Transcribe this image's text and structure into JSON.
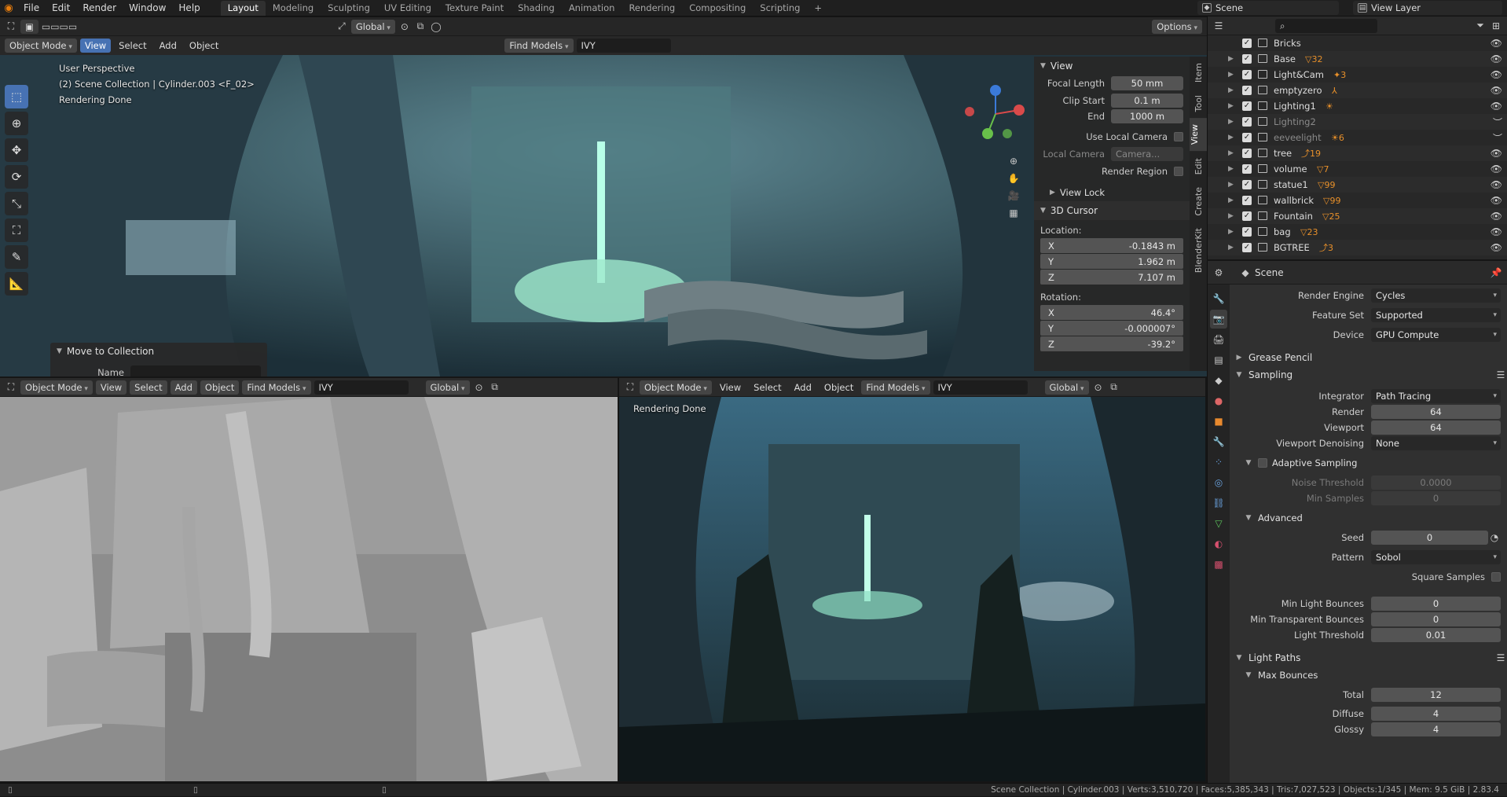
{
  "topbar": {
    "menus": [
      "File",
      "Edit",
      "Render",
      "Window",
      "Help"
    ],
    "workspaces": [
      "Layout",
      "Modeling",
      "Sculpting",
      "UV Editing",
      "Texture Paint",
      "Shading",
      "Animation",
      "Rendering",
      "Compositing",
      "Scripting"
    ],
    "active_workspace": "Layout",
    "scene_name": "Scene",
    "view_layer": "View Layer"
  },
  "viewport_main": {
    "mode": "Object Mode",
    "menus": [
      "View",
      "Select",
      "Add",
      "Object"
    ],
    "transform_orientation": "Global",
    "find_models": "Find Models",
    "search": "IVY",
    "options": "Options",
    "overlay_lines": [
      "User Perspective",
      "(2) Scene Collection | Cylinder.003 <F_02>",
      "Rendering Done"
    ],
    "last_op": {
      "title": "Move to Collection",
      "name_label": "Name",
      "name_value": ""
    }
  },
  "npanel": {
    "tabs": [
      "Item",
      "Tool",
      "View",
      "Edit",
      "Create",
      "BlenderKit"
    ],
    "active_tab": "View",
    "view_header": "View",
    "focal_length_label": "Focal Length",
    "focal_length": "50 mm",
    "clip_start_label": "Clip Start",
    "clip_start": "0.1 m",
    "end_label": "End",
    "end": "1000 m",
    "use_local_camera": "Use Local Camera",
    "local_camera_label": "Local Camera",
    "local_camera": "Camera...",
    "render_region": "Render Region",
    "view_lock": "View Lock",
    "cursor_header": "3D Cursor",
    "location_label": "Location:",
    "loc_x": "-0.1843 m",
    "loc_y": "1.962 m",
    "loc_z": "7.107 m",
    "rotation_label": "Rotation:",
    "rot_x": "46.4°",
    "rot_y": "-0.000007°",
    "rot_z": "-39.2°",
    "axis_x": "X",
    "axis_y": "Y",
    "axis_z": "Z"
  },
  "viewport_left": {
    "mode": "Object Mode",
    "menus": [
      "View",
      "Select",
      "Add",
      "Object"
    ],
    "find_models": "Find Models",
    "search": "IVY",
    "transform_orientation": "Global"
  },
  "viewport_right": {
    "mode": "Object Mode",
    "menus": [
      "View",
      "Select",
      "Add",
      "Object"
    ],
    "find_models": "Find Models",
    "search": "IVY",
    "transform_orientation": "Global",
    "overlay": "Rendering Done"
  },
  "outliner": {
    "items": [
      {
        "name": "Bricks",
        "badge": "",
        "dim": false
      },
      {
        "name": "Base",
        "badge": "▽32",
        "dim": false
      },
      {
        "name": "Light&Cam",
        "badge": "✦3",
        "dim": false
      },
      {
        "name": "emptyzero",
        "badge": "⅄",
        "dim": false
      },
      {
        "name": "Lighting1",
        "badge": "☀",
        "dim": false
      },
      {
        "name": "Lighting2",
        "badge": "",
        "dim": true
      },
      {
        "name": "eeveelight",
        "badge": "☀6",
        "dim": true
      },
      {
        "name": "tree",
        "badge": "⤴19",
        "dim": false
      },
      {
        "name": "volume",
        "badge": "▽7",
        "dim": false
      },
      {
        "name": "statue1",
        "badge": "▽99",
        "dim": false
      },
      {
        "name": "wallbrick",
        "badge": "▽99",
        "dim": false
      },
      {
        "name": "Fountain",
        "badge": "▽25",
        "dim": false
      },
      {
        "name": "bag",
        "badge": "▽23",
        "dim": false
      },
      {
        "name": "BGTREE",
        "badge": "⤴3",
        "dim": false
      }
    ]
  },
  "properties": {
    "context": "Scene",
    "render_engine_label": "Render Engine",
    "render_engine": "Cycles",
    "feature_set_label": "Feature Set",
    "feature_set": "Supported",
    "device_label": "Device",
    "device": "GPU Compute",
    "grease_pencil": "Grease Pencil",
    "sampling": "Sampling",
    "integrator_label": "Integrator",
    "integrator": "Path Tracing",
    "render_label": "Render",
    "render": "64",
    "viewport_label": "Viewport",
    "viewport": "64",
    "viewport_denoising_label": "Viewport Denoising",
    "viewport_denoising": "None",
    "adaptive_sampling": "Adaptive Sampling",
    "noise_threshold_label": "Noise Threshold",
    "noise_threshold": "0.0000",
    "min_samples_label": "Min Samples",
    "min_samples": "0",
    "advanced": "Advanced",
    "seed_label": "Seed",
    "seed": "0",
    "pattern_label": "Pattern",
    "pattern": "Sobol",
    "square_samples": "Square Samples",
    "min_light_bounces_label": "Min Light Bounces",
    "min_light_bounces": "0",
    "min_transparent_bounces_label": "Min Transparent Bounces",
    "min_transparent_bounces": "0",
    "light_threshold_label": "Light Threshold",
    "light_threshold": "0.01",
    "light_paths": "Light Paths",
    "max_bounces": "Max Bounces",
    "total_label": "Total",
    "total": "12",
    "diffuse_label": "Diffuse",
    "diffuse": "4",
    "glossy_label": "Glossy",
    "glossy": "4"
  },
  "statusbar": {
    "stats": "Scene Collection | Cylinder.003 | Verts:3,510,720 | Faces:5,385,343 | Tris:7,027,523 | Objects:1/345 | Mem: 9.5 GiB | 2.83.4"
  }
}
